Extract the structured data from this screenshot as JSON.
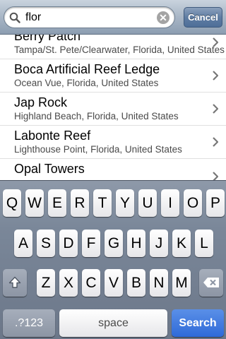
{
  "search": {
    "query": "flor",
    "clear_glyph": "✕",
    "cancel_label": "Cancel"
  },
  "results": [
    {
      "name": "Berry Patch",
      "location": "Tampa/St. Pete/Clearwater, Florida, United States"
    },
    {
      "name": "Boca Artificial Reef Ledge",
      "location": "Ocean Vue, Florida, United States"
    },
    {
      "name": "Jap Rock",
      "location": "Highland Beach, Florida, United States"
    },
    {
      "name": "Labonte Reef",
      "location": "Lighthouse Point, Florida, United States"
    },
    {
      "name": "Opal Towers",
      "location": ""
    }
  ],
  "keyboard": {
    "row1": [
      "Q",
      "W",
      "E",
      "R",
      "T",
      "Y",
      "U",
      "I",
      "O",
      "P"
    ],
    "row2": [
      "A",
      "S",
      "D",
      "F",
      "G",
      "H",
      "J",
      "K",
      "L"
    ],
    "row3": [
      "Z",
      "X",
      "C",
      "V",
      "B",
      "N",
      "M"
    ],
    "numbers_label": ".?123",
    "space_label": "space",
    "search_label": "Search",
    "shift_icon": "shift-icon",
    "backspace_icon": "backspace-icon"
  },
  "colors": {
    "accent": "#2f6ad8",
    "cancel": "#5f7da3"
  }
}
